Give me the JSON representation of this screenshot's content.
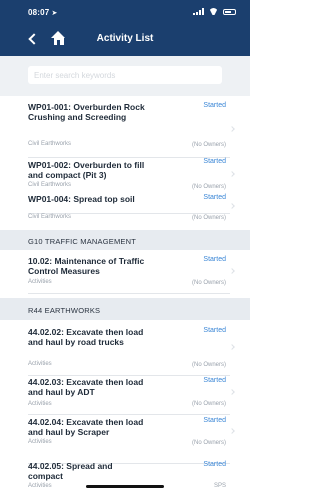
{
  "status": {
    "time": "08:07",
    "location_glyph": "➤"
  },
  "header": {
    "title": "Activity List"
  },
  "search": {
    "placeholder": "Enter search keywords"
  },
  "items": [
    {
      "title": "WP01-001: Overburden Rock Crushing and Screeding",
      "category": "Civil Earthworks",
      "status": "Started",
      "owner": "(No Owners)"
    },
    {
      "title": "WP01-002: Overburden to fill and compact (Pit 3)",
      "category": "Civil Earthworks",
      "status": "Started",
      "owner": "(No Owners)"
    },
    {
      "title": "WP01-004: Spread top soil",
      "category": "Civil Earthworks",
      "status": "Started",
      "owner": "(No Owners)"
    },
    {
      "title": "10.02: Maintenance of Traffic Control Measures",
      "category": "Activities",
      "status": "Started",
      "owner": "(No Owners)"
    },
    {
      "title": "44.02.02: Excavate then load and haul by road trucks",
      "category": "Activities",
      "status": "Started",
      "owner": "(No Owners)"
    },
    {
      "title": "44.02.03: Excavate then load and haul by ADT",
      "category": "Activities",
      "status": "Started",
      "owner": "(No Owners)"
    },
    {
      "title": "44.02.04: Excavate then load and haul by Scraper",
      "category": "Activities",
      "status": "Started",
      "owner": "(No Owners)"
    },
    {
      "title": "44.02.05: Spread and compact",
      "category": "Activities",
      "status": "Started",
      "owner": "SPS"
    }
  ],
  "sections": [
    {
      "label": "G10 TRAFFIC MANAGEMENT"
    },
    {
      "label": "R44 EARTHWORKS"
    }
  ],
  "colors": {
    "header": "#1b3f6e",
    "status_text": "#3a86d6",
    "section_bg": "#e7ebf0"
  }
}
